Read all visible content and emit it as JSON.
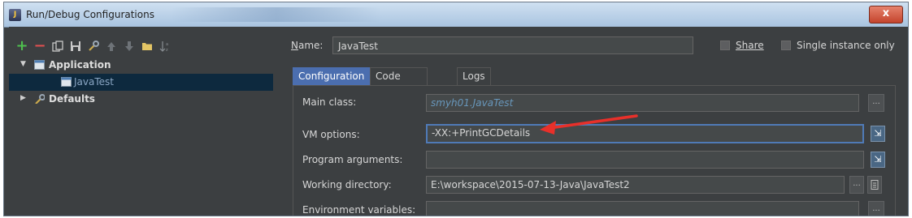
{
  "window": {
    "title": "Run/Debug Configurations",
    "close": "x",
    "app_icon_text": "J"
  },
  "toolbar": [
    "add-icon",
    "remove-icon",
    "copy-icon",
    "save-icon",
    "wrench-icon",
    "move-up-icon",
    "move-down-icon",
    "folder-icon",
    "sort-icon"
  ],
  "tree": {
    "application": "Application",
    "javatest": "JavaTest",
    "defaults": "Defaults"
  },
  "header": {
    "name_label_first": "N",
    "name_label_rest": "ame:",
    "name_value": "JavaTest",
    "share_label": "Share",
    "single_instance_label": "Single instance only"
  },
  "tabs": [
    "Configuration",
    "Code Coverage",
    "Logs"
  ],
  "form": {
    "main_class_label": "Main class:",
    "main_class_value": "smyh01.JavaTest",
    "vm_options_label": "VM options:",
    "vm_options_value": "-XX:+PrintGCDetails",
    "program_args_label": "Program arguments:",
    "program_args_value": "",
    "working_dir_label": "Working directory:",
    "working_dir_value": "E:\\workspace\\2015-07-13-Java\\JavaTest2",
    "env_vars_label": "Environment variables:",
    "env_vars_value": "",
    "browse_label": "...",
    "expand_label": "⇲"
  },
  "colors": {
    "annotation_arrow": "#e8302a",
    "selection": "#0d293e",
    "active_tab": "#4b6eaf"
  }
}
